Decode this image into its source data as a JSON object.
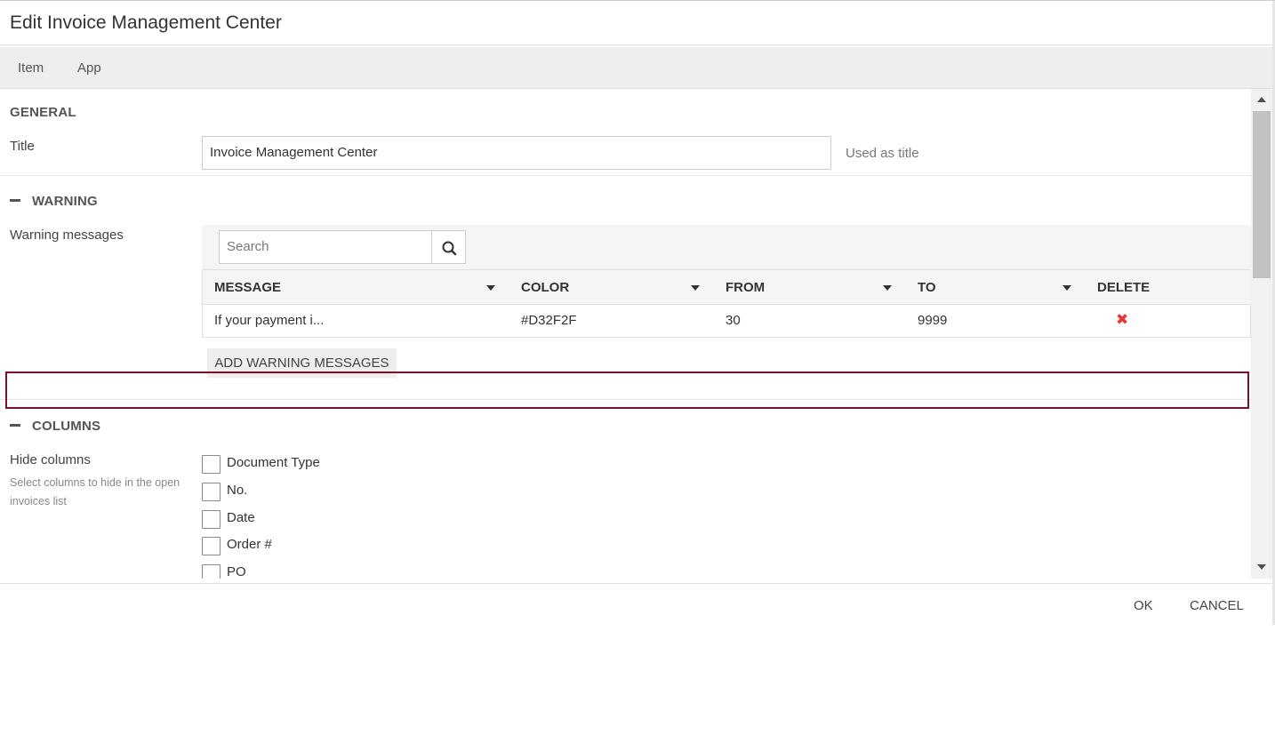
{
  "dialog": {
    "title": "Edit Invoice Management Center"
  },
  "menu": {
    "items": [
      "Item",
      "App"
    ]
  },
  "general": {
    "heading": "GENERAL",
    "title_label": "Title",
    "title_value": "Invoice Management Center",
    "title_hint": "Used as title"
  },
  "warning": {
    "heading": "WARNING",
    "messages_label": "Warning messages",
    "search_placeholder": "Search",
    "columns": [
      "MESSAGE",
      "COLOR",
      "FROM",
      "TO",
      "DELETE"
    ],
    "rows": [
      {
        "message": "If your payment i...",
        "color": "#D32F2F",
        "from": "30",
        "to": "9999"
      }
    ],
    "add_button": "ADD WARNING MESSAGES"
  },
  "columns_section": {
    "heading": "COLUMNS",
    "hide_label": "Hide columns",
    "hide_hint": "Select columns to hide in the open invoices list",
    "options": [
      "Document Type",
      "No.",
      "Date",
      "Order #",
      "PO"
    ]
  },
  "footer": {
    "ok": "OK",
    "cancel": "CANCEL"
  },
  "colors": {
    "highlight": "#7b1026",
    "delete": "#e53935",
    "menubar_bg": "#eeeeee"
  },
  "icons": {
    "search": "search-icon",
    "collapse": "minus-icon",
    "delete": "close-icon",
    "sort": "caret-down-icon"
  }
}
